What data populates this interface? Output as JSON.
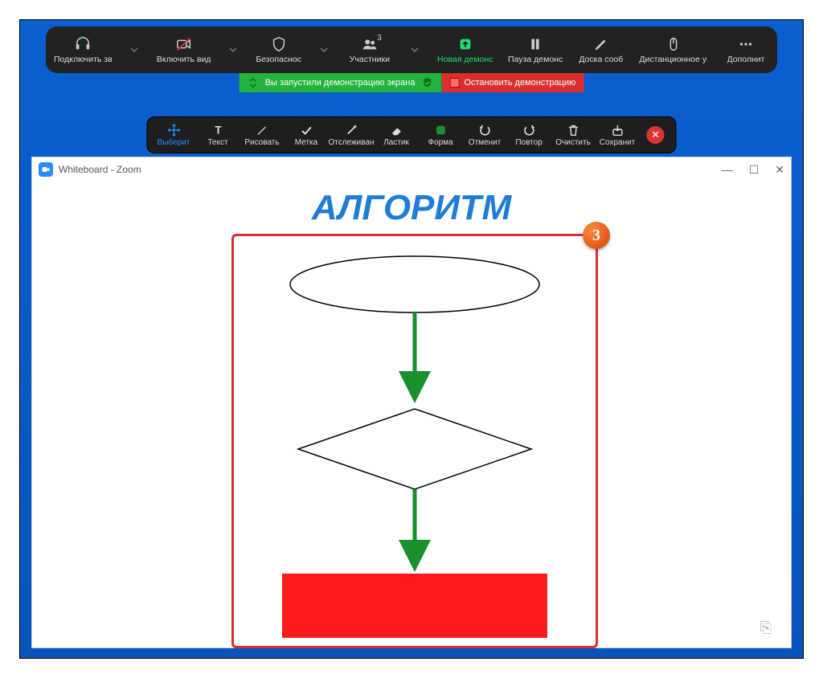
{
  "topbar": {
    "audio_label": "Подключить зв",
    "video_label": "Включить вид",
    "security_label": "Безопаснос",
    "participants_label": "Участники",
    "participants_count": "3",
    "new_share_label": "Новая демонс",
    "pause_share_label": "Пауза демонс",
    "whiteboard_label": "Доска сооб",
    "remote_label": "Дистанционное уп",
    "more_label": "Дополнит"
  },
  "statusbar": {
    "sharing_text": "Вы запустили демонстрацию экрана",
    "stop_text": "Остановить демонстрацию"
  },
  "annobar": {
    "select": "Выберит",
    "text": "Текст",
    "draw": "Рисовать",
    "stamp": "Метка",
    "spotlight": "Отслеживан",
    "eraser": "Ластик",
    "format": "Форма",
    "undo": "Отменит",
    "redo": "Повтор",
    "clear": "Очистить",
    "save": "Сохранит"
  },
  "whiteboard": {
    "title": "Whiteboard - Zoom",
    "canvas_title": "АЛГОРИТМ",
    "step_number": "3",
    "chart_data": {
      "type": "flowchart",
      "nodes": [
        {
          "id": "n1",
          "shape": "ellipse",
          "fill": "none",
          "stroke": "#000"
        },
        {
          "id": "n2",
          "shape": "diamond",
          "fill": "none",
          "stroke": "#000"
        },
        {
          "id": "n3",
          "shape": "rectangle",
          "fill": "#ff1a1a",
          "stroke": "none"
        }
      ],
      "edges": [
        {
          "from": "n1",
          "to": "n2",
          "color": "#1a8f2e"
        },
        {
          "from": "n2",
          "to": "n3",
          "color": "#1a8f2e"
        }
      ]
    }
  }
}
